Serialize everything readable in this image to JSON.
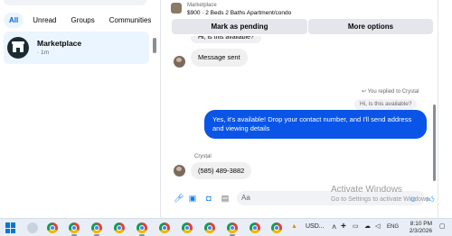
{
  "sidebar": {
    "filters": [
      "All",
      "Unread",
      "Groups",
      "Communities"
    ],
    "active_filter": "All",
    "conversation": {
      "name": "Marketplace",
      "time": "· 1m"
    }
  },
  "chat": {
    "header": {
      "source": "Marketplace",
      "listing_title": "$900 · 2 Beds 2 Baths Apartment/condo",
      "mark_pending_label": "Mark as pending",
      "more_options_label": "More options"
    },
    "messages": {
      "top_cut": "Hi, is this available?",
      "message_sent": "Message sent",
      "reply_note": "You replied to Crystal",
      "quoted": "Hi, is this available?",
      "outgoing": "Yes, it's available! Drop your contact number, and I'll send address and viewing details",
      "sender_name": "Crystal",
      "incoming_phone": "(585) 489-3882"
    },
    "composer": {
      "placeholder": "Aa"
    }
  },
  "watermark": {
    "line1": "Activate Windows",
    "line2": "Go to Settings to activate Windows."
  },
  "taskbar": {
    "stock": "USD...",
    "tray_lang": "ENG",
    "time": "8:10 PM",
    "date": "2/3/2026"
  },
  "colors": {
    "accent": "#0a7cff",
    "outgoing_bubble": "#0a55e8",
    "active_chip_bg": "#ebf5ff"
  }
}
